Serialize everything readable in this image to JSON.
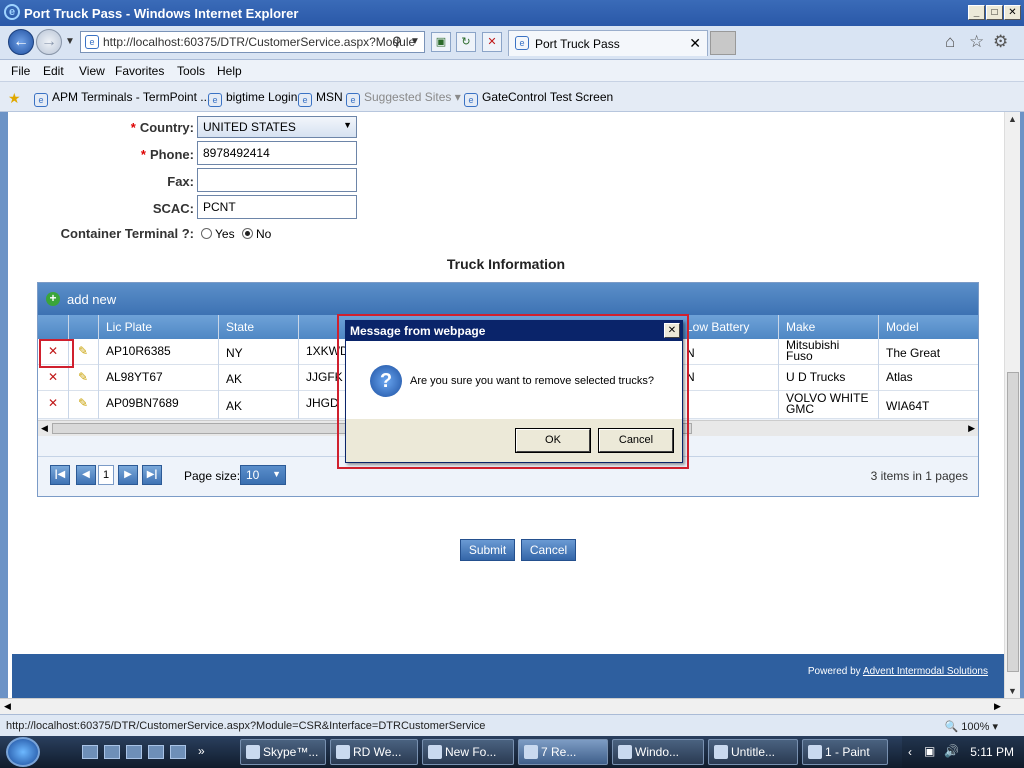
{
  "window": {
    "title": "Port Truck Pass - Windows Internet Explorer",
    "minimize": "_",
    "maximize": "□",
    "close": "✕"
  },
  "browser": {
    "address": "http://localhost:60375/DTR/CustomerService.aspx?Module",
    "tab_title": "Port Truck Pass",
    "tab_close": "✕"
  },
  "menu": [
    "File",
    "Edit",
    "View",
    "Favorites",
    "Tools",
    "Help"
  ],
  "favorites": [
    {
      "label": "APM Terminals - TermPoint ...",
      "disabled": false
    },
    {
      "label": "bigtime Login",
      "disabled": false
    },
    {
      "label": "MSN",
      "disabled": false
    },
    {
      "label": "Suggested Sites ▾",
      "disabled": true
    },
    {
      "label": "GateControl Test Screen",
      "disabled": false
    }
  ],
  "form": {
    "country_label": "Country:",
    "country_value": "UNITED STATES",
    "phone_label": "Phone:",
    "phone_value": "8978492414",
    "fax_label": "Fax:",
    "fax_value": "",
    "scac_label": "SCAC:",
    "scac_value": "PCNT",
    "container_label": "Container Terminal ?:",
    "radio_yes": "Yes",
    "radio_no": "No",
    "selected": "No",
    "required_mark": "*"
  },
  "truck_section": {
    "title": "Truck Information",
    "add_new": "add new",
    "columns": [
      "Lic Plate",
      "State",
      "Low Battery",
      "Make",
      "Model"
    ],
    "rows": [
      {
        "plate": "AP10R6385",
        "state": "NY",
        "vin": "1XKWD",
        "battery": "N",
        "make": "Mitsubishi Fuso",
        "model": "The Great"
      },
      {
        "plate": "AL98YT67",
        "state": "AK",
        "vin": "JJGFK",
        "battery": "N",
        "make": "U D Trucks",
        "model": "Atlas"
      },
      {
        "plate": "AP09BN7689",
        "state": "AK",
        "vin": "JHGD",
        "battery": "",
        "make": "VOLVO WHITE GMC",
        "model": "WIA64T"
      }
    ],
    "pager": {
      "page": "1",
      "page_size_label": "Page size:",
      "page_size": "10",
      "summary": "3 items in 1 pages"
    }
  },
  "actions": {
    "submit": "Submit",
    "cancel": "Cancel"
  },
  "footer": {
    "powered_by": "Powered by",
    "company": "Advent Intermodal Solutions"
  },
  "dialog": {
    "title": "Message from webpage",
    "message": "Are you sure you want to remove selected trucks?",
    "ok": "OK",
    "cancel": "Cancel"
  },
  "status": {
    "url": "http://localhost:60375/DTR/CustomerService.aspx?Module=CSR&Interface=DTRCustomerService",
    "zoom": "100%"
  },
  "taskbar": {
    "items": [
      {
        "label": "Skype™...",
        "active": false
      },
      {
        "label": "RD We...",
        "active": false
      },
      {
        "label": "New Fo...",
        "active": false
      },
      {
        "label": "7 Re...",
        "active": true
      },
      {
        "label": "Windo...",
        "active": false
      },
      {
        "label": "Untitle...",
        "active": false
      },
      {
        "label": "1 - Paint",
        "active": false
      }
    ],
    "clock": "5:11 PM"
  }
}
